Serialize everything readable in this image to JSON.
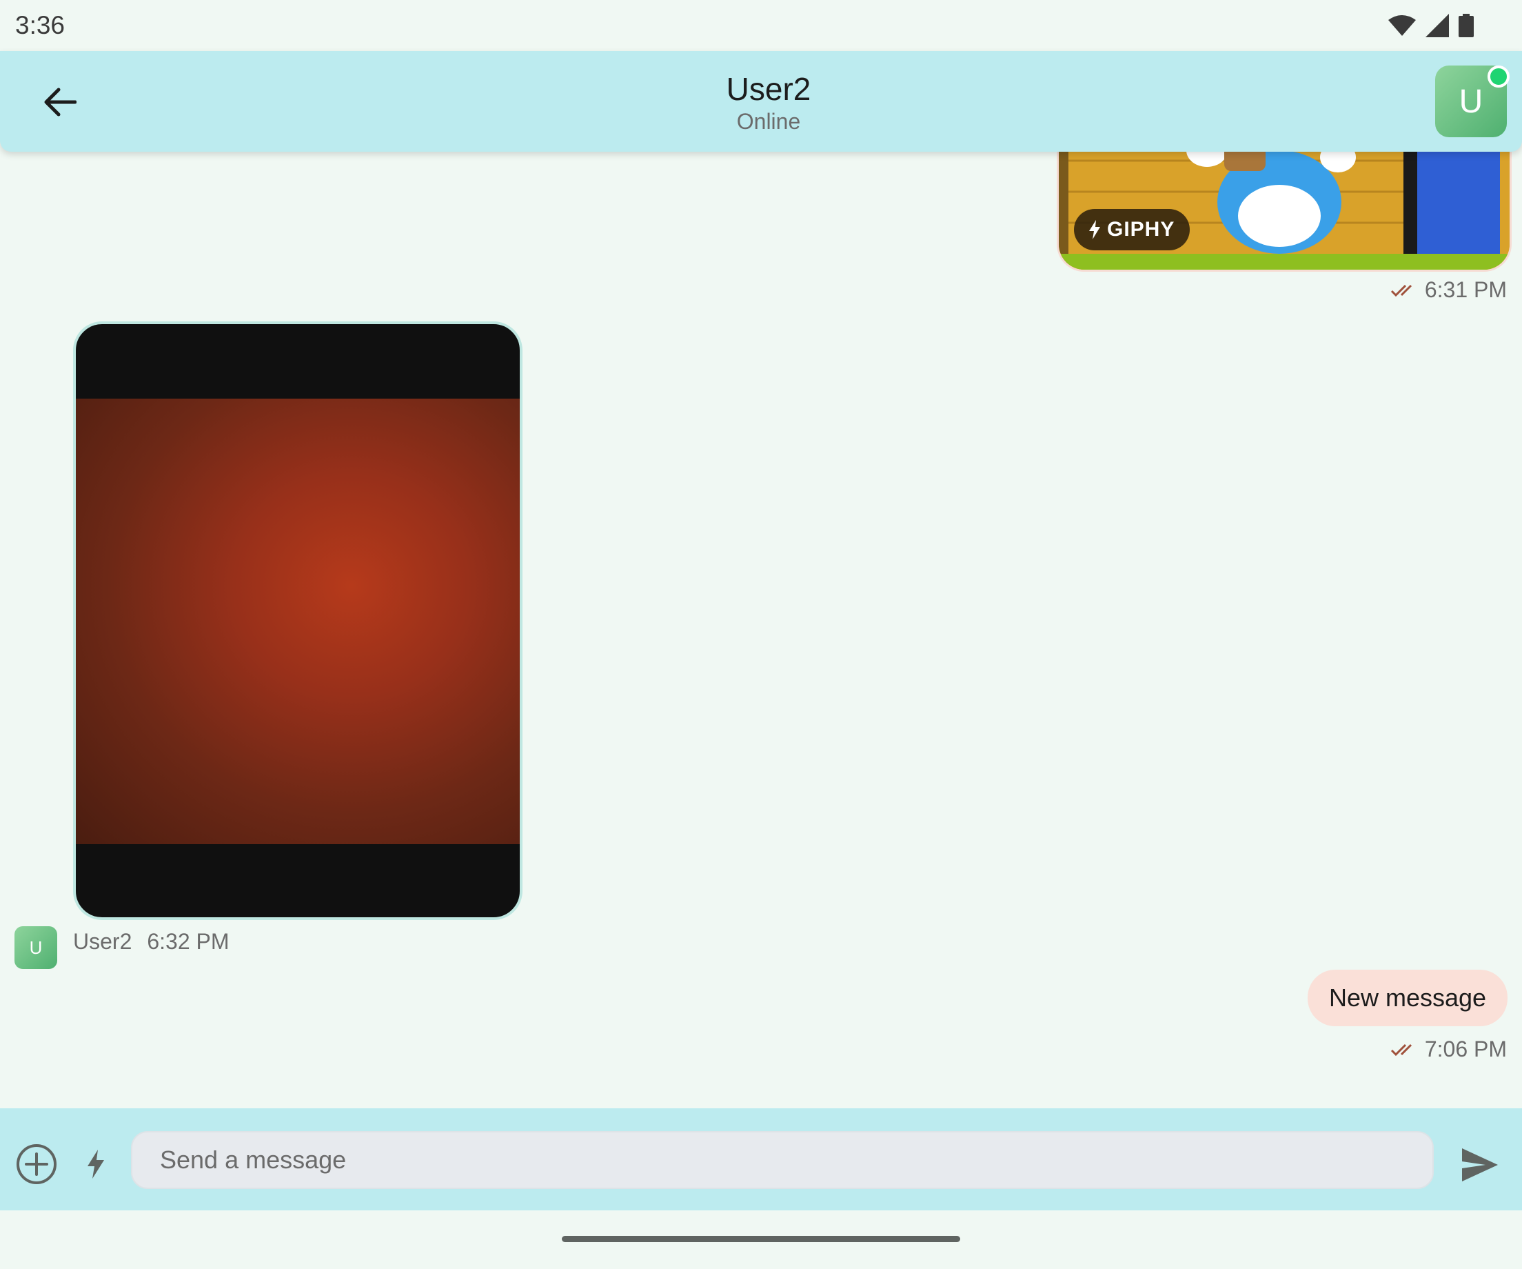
{
  "status_bar": {
    "time": "3:36"
  },
  "header": {
    "title": "User2",
    "subtitle": "Online",
    "avatar_initial": "U",
    "icons": {
      "back": "arrow-left-icon"
    }
  },
  "messages": {
    "giphy": {
      "badge": "GIPHY",
      "time": "6:31 PM"
    },
    "photo": {
      "sender": "User2",
      "time": "6:32 PM",
      "avatar_initial": "U"
    },
    "outgoing": {
      "text": "New message",
      "time": "7:06 PM"
    }
  },
  "composer": {
    "placeholder": "Send a message",
    "icons": {
      "attach": "plus-circle-icon",
      "commands": "lightning-icon",
      "send": "send-icon"
    }
  },
  "colors": {
    "header_bg": "#bcebef",
    "page_bg": "#f0f8f3",
    "outgoing_bubble": "#fae0d8",
    "online": "#1fd472",
    "read_check": "#a0523c"
  }
}
